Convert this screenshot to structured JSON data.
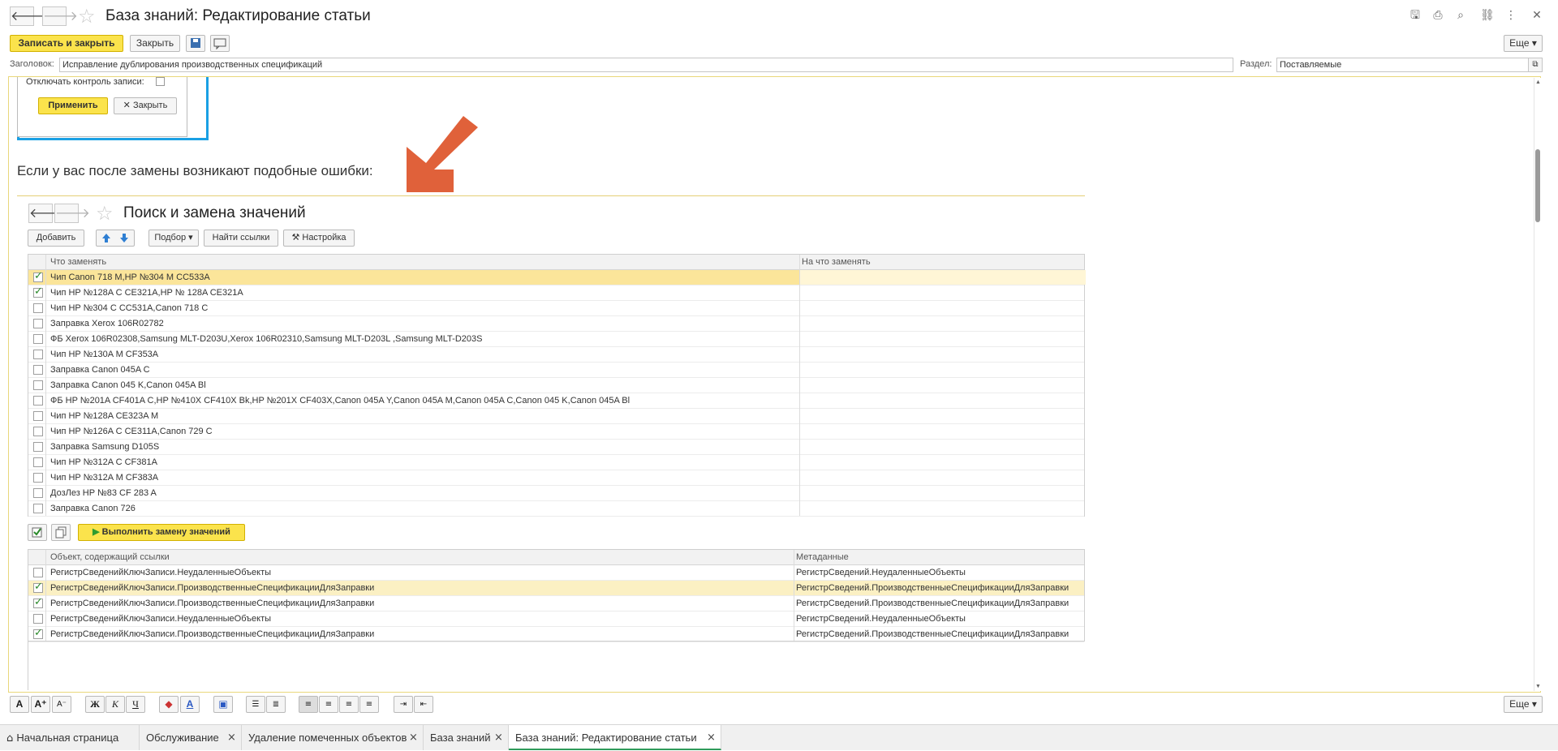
{
  "window": {
    "title": "База знаний: Редактирование статьи",
    "back_glyph": "🡐",
    "forward_glyph": "🡒",
    "icons": [
      "save-icon",
      "print-icon",
      "preview-icon",
      "link-icon",
      "more-icon",
      "close-icon"
    ]
  },
  "toolbar": {
    "save_close_label": "Записать и закрыть",
    "close_label": "Закрыть",
    "more_label": "Еще"
  },
  "form": {
    "title_label": "Заголовок:",
    "title_value": "Исправление дублирования производственных спецификаций",
    "section_label": "Раздел:",
    "section_value": "Поставляемые"
  },
  "article": {
    "embedded_panel": {
      "checkbox_label": "Отключать контроль записи:",
      "apply_label": "Применить",
      "close_label": "Закрыть"
    },
    "paragraph": "Если у вас после замены возникают подобные ошибки:",
    "search_replace": {
      "title": "Поиск и замена значений",
      "buttons": {
        "add": "Добавить",
        "pick": "Подбор",
        "find_links": "Найти ссылки",
        "settings": "Настройка",
        "execute": "Выполнить замену значений"
      },
      "grid1": {
        "col_what": "Что заменять",
        "col_to": "На что заменять",
        "rows": [
          {
            "checked": true,
            "text": "Чип Canon 718 M,HP №304 M CC533A",
            "selected": true
          },
          {
            "checked": true,
            "text": "Чип HP №128A C CE321A,HP № 128A CE321A",
            "selected": false
          },
          {
            "checked": false,
            "text": "Чип HP №304 C CC531A,Canon 718 C",
            "selected": false
          },
          {
            "checked": false,
            "text": "Заправка Xerox 106R02782",
            "selected": false
          },
          {
            "checked": false,
            "text": "ФБ Xerox 106R02308,Samsung MLT-D203U,Xerox 106R02310,Samsung MLT-D203L ,Samsung MLT-D203S",
            "selected": false
          },
          {
            "checked": false,
            "text": "Чип HP №130A M CF353A",
            "selected": false
          },
          {
            "checked": false,
            "text": "Заправка Canon 045A C",
            "selected": false
          },
          {
            "checked": false,
            "text": "Заправка Canon 045  K,Canon 045A Bl",
            "selected": false
          },
          {
            "checked": false,
            "text": "ФБ HP №201A CF401A C,HP №410X CF410X Bk,HP №201X CF403X,Canon 045A Y,Canon 045A M,Canon 045A C,Canon 045  K,Canon 045A Bl",
            "selected": false
          },
          {
            "checked": false,
            "text": "Чип HP №128A CE323A M",
            "selected": false
          },
          {
            "checked": false,
            "text": "Чип HP №126A C CE311A,Canon 729 C",
            "selected": false
          },
          {
            "checked": false,
            "text": "Заправка Samsung D105S",
            "selected": false
          },
          {
            "checked": false,
            "text": "Чип HP  №312A C CF381A",
            "selected": false
          },
          {
            "checked": false,
            "text": "Чип HP  №312A M CF383A",
            "selected": false
          },
          {
            "checked": false,
            "text": "ДозЛез HP №83 CF 283 A",
            "selected": false
          },
          {
            "checked": false,
            "text": "Заправка Canon 726",
            "selected": false
          }
        ]
      },
      "grid2": {
        "col_object": "Объект, содержащий ссылки",
        "col_meta": "Метаданные",
        "rows": [
          {
            "checked": false,
            "object": "РегистрСведенийКлючЗаписи.НеудаленныеОбъекты",
            "meta": "РегистрСведений.НеудаленныеОбъекты",
            "selected": false
          },
          {
            "checked": true,
            "object": "РегистрСведенийКлючЗаписи.ПроизводственныеСпецификацииДляЗаправки",
            "meta": "РегистрСведений.ПроизводственныеСпецификацииДляЗаправки",
            "selected": true
          },
          {
            "checked": true,
            "object": "РегистрСведенийКлючЗаписи.ПроизводственныеСпецификацииДляЗаправки",
            "meta": "РегистрСведений.ПроизводственныеСпецификацииДляЗаправки",
            "selected": false
          },
          {
            "checked": false,
            "object": "РегистрСведенийКлючЗаписи.НеудаленныеОбъекты",
            "meta": "РегистрСведений.НеудаленныеОбъекты",
            "selected": false
          },
          {
            "checked": true,
            "object": "РегистрСведенийКлючЗаписи.ПроизводственныеСпецификацииДляЗаправки",
            "meta": "РегистрСведений.ПроизводственныеСпецификацииДляЗаправки",
            "selected": false
          }
        ]
      }
    }
  },
  "format_toolbar": {
    "bold": "Ж",
    "italic": "К",
    "underline": "Ч",
    "font_a": "A",
    "more_label": "Еще"
  },
  "tabs": [
    {
      "label": "Начальная страница",
      "closable": false,
      "active": false
    },
    {
      "label": "Обслуживание",
      "closable": true,
      "active": false
    },
    {
      "label": "Удаление помеченных объектов",
      "closable": true,
      "active": false
    },
    {
      "label": "База знаний",
      "closable": true,
      "active": false
    },
    {
      "label": "База знаний: Редактирование статьи",
      "closable": true,
      "active": true
    }
  ],
  "colors": {
    "accent_yellow": "#fbe34c",
    "selection": "#fbf0c3",
    "frame_blue": "#1aa0e4",
    "arrow_orange": "#e0613a",
    "active_tab_green": "#2f9b5b"
  }
}
